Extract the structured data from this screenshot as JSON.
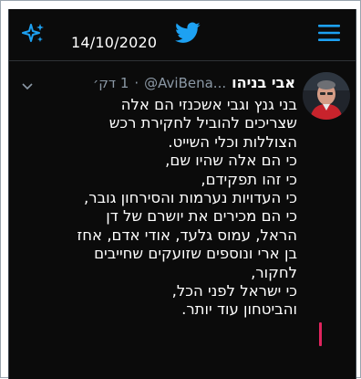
{
  "header": {
    "date": "14/10/2020",
    "sparkle_icon": "sparkle-icon",
    "bird_icon": "twitter-bird-icon",
    "menu_icon": "hamburger-menu-icon"
  },
  "tweet": {
    "author_name": "אבי בניהו",
    "handle": "@AviBena...",
    "separator": "·",
    "time": "1 דק׳",
    "lines": [
      "בני גנץ וגבי אשכנזי הם אלה",
      "שצריכים להוביל לחקירת רכש",
      "הצוללות וכלי השייט.",
      "כי הם אלה שהיו שם,",
      "כי זהו תפקידם,",
      "כי העדויות נערמות והסירחון גובר,",
      "כי הם מכירים את יושרם של דן",
      "הראל, עמוס גלעד, אודי אדם, אחז",
      "בן ארי ונוספים שזועקים שחייבים",
      "לחקור,",
      "כי ישראל לפני הכל,",
      "והביטחון עוד יותר."
    ]
  },
  "colors": {
    "background": "#0b0b0b",
    "accent": "#1da1f2",
    "text": "#ffffff",
    "secondary_text": "#8b98a5",
    "mark": "#e0245e"
  }
}
